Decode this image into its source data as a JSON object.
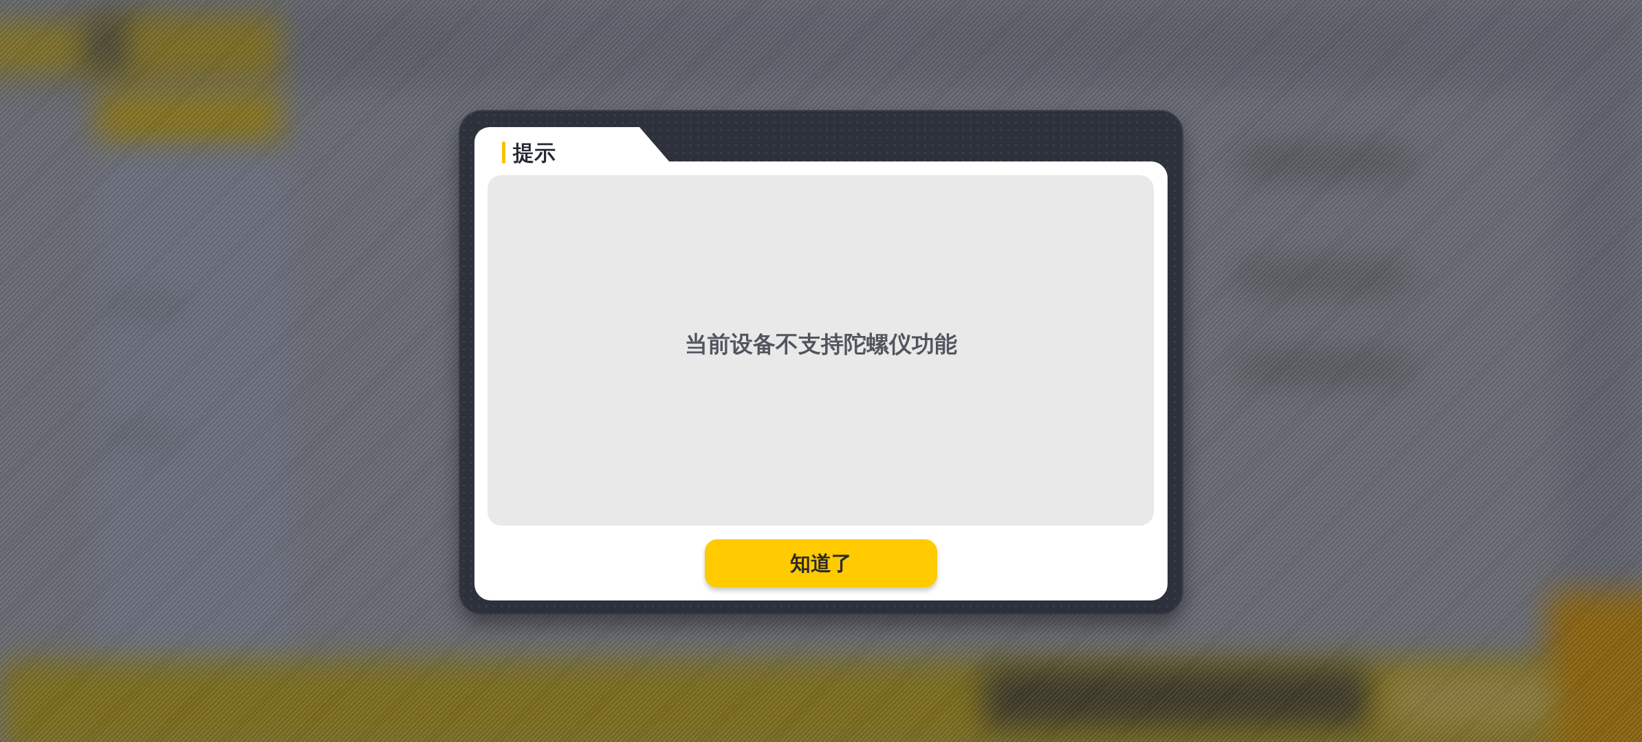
{
  "dialog": {
    "title": "提示",
    "message": "当前设备不支持陀螺仪功能",
    "button": {
      "label": "知道了"
    }
  }
}
